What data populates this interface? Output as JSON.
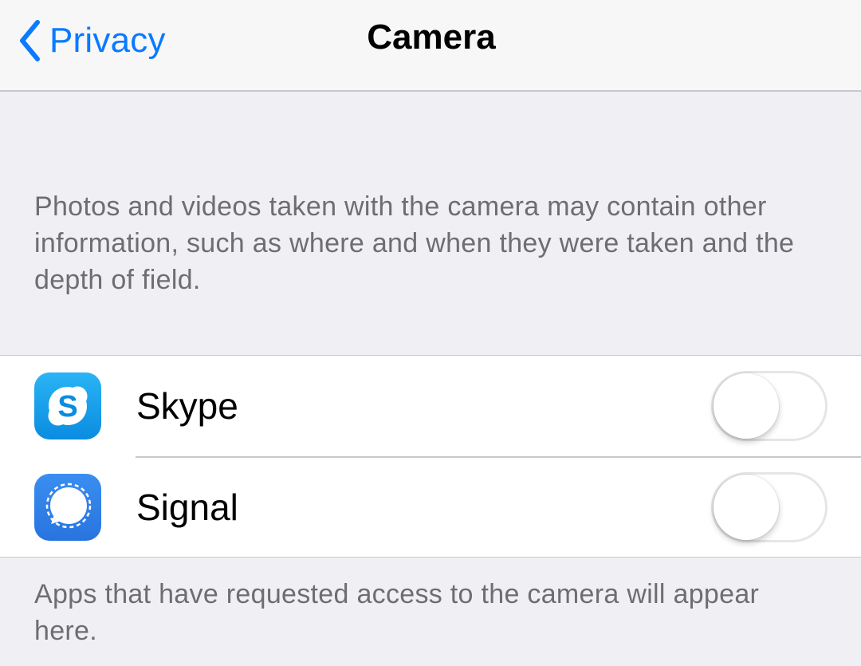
{
  "navbar": {
    "back_label": "Privacy",
    "title": "Camera"
  },
  "header_note": "Photos and videos taken with the camera may contain other information, such as where and when they were taken and the depth of field.",
  "apps": [
    {
      "name": "Skype",
      "icon": "skype-icon",
      "enabled": false
    },
    {
      "name": "Signal",
      "icon": "signal-icon",
      "enabled": false
    }
  ],
  "footer_note": "Apps that have requested access to the camera will appear here.",
  "colors": {
    "accent": "#0a7aff",
    "background": "#efeff4",
    "secondary_text": "#6d6d72",
    "separator": "#c8c7cc"
  }
}
